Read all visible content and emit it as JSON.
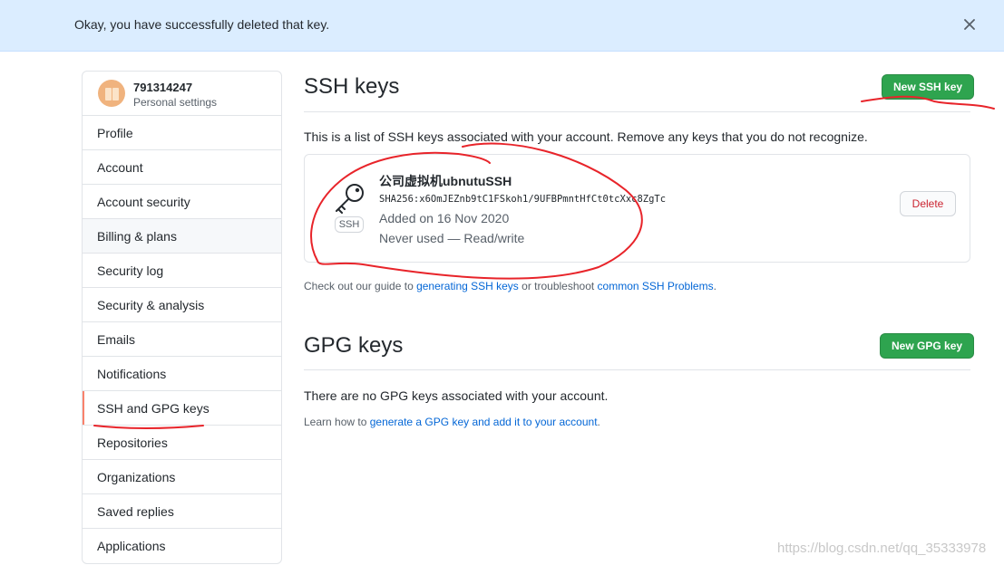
{
  "flash": {
    "message": "Okay, you have successfully deleted that key.",
    "close_icon": "x-icon"
  },
  "sidebar": {
    "username": "791314247",
    "subtitle": "Personal settings",
    "items": [
      {
        "label": "Profile"
      },
      {
        "label": "Account"
      },
      {
        "label": "Account security"
      },
      {
        "label": "Billing & plans"
      },
      {
        "label": "Security log"
      },
      {
        "label": "Security & analysis"
      },
      {
        "label": "Emails"
      },
      {
        "label": "Notifications"
      },
      {
        "label": "SSH and GPG keys"
      },
      {
        "label": "Repositories"
      },
      {
        "label": "Organizations"
      },
      {
        "label": "Saved replies"
      },
      {
        "label": "Applications"
      }
    ],
    "selected_label": "SSH and GPG keys"
  },
  "ssh": {
    "title": "SSH keys",
    "new_button": "New SSH key",
    "description": "This is a list of SSH keys associated with your account. Remove any keys that you do not recognize.",
    "key": {
      "type_label": "SSH",
      "title": "公司虚拟机ubnutuSSH",
      "fingerprint": "SHA256:x6OmJEZnb9tC1FSkoh1/9UFBPmntHfCt0tcXxc8ZgTc",
      "added": "Added on 16 Nov 2020",
      "usage": "Never used — Read/write",
      "delete_button": "Delete"
    },
    "guide": {
      "prefix": "Check out our guide to ",
      "link1": "generating SSH keys",
      "middle": " or troubleshoot ",
      "link2": "common SSH Problems",
      "suffix": "."
    }
  },
  "gpg": {
    "title": "GPG keys",
    "new_button": "New GPG key",
    "empty_text": "There are no GPG keys associated with your account.",
    "learn": {
      "prefix": "Learn how to ",
      "link": "generate a GPG key and add it to your account",
      "suffix": "."
    }
  },
  "watermark": "https://blog.csdn.net/qq_35333978",
  "colors": {
    "flash_bg": "#dbedff",
    "green": "#2ea44f",
    "link": "#0366d6",
    "danger": "#cb2431",
    "selected_marker": "#f9826c",
    "annotation": "#e8242a"
  }
}
